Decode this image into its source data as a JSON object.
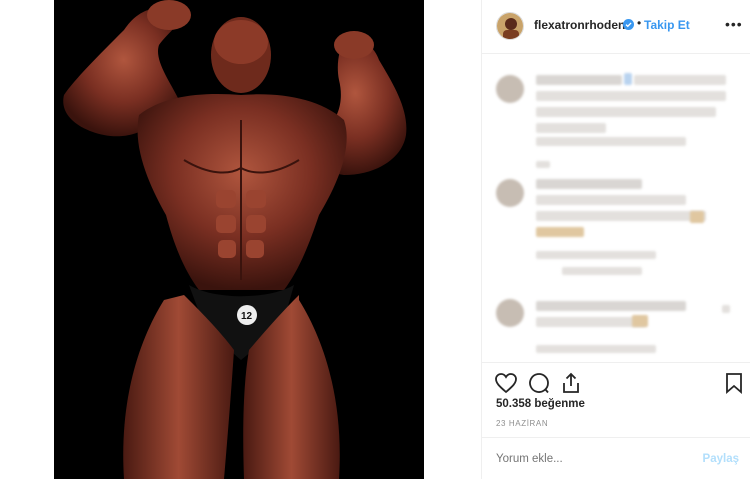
{
  "post": {
    "username": "flexatronrhoden",
    "follow_label": "Takip Et",
    "dot": "•",
    "more_label": "•••",
    "likes_text": "50.358 beğenme",
    "date_text": "23 HAZİRAN",
    "comment_placeholder": "Yorum ekle...",
    "share_label": "Paylaş"
  },
  "colors": {
    "accent": "#3897f0",
    "share_disabled": "#b2dffc"
  },
  "icons": [
    "verified-badge-icon",
    "more-options-icon",
    "heart-icon",
    "comment-icon",
    "share-icon",
    "bookmark-icon"
  ]
}
